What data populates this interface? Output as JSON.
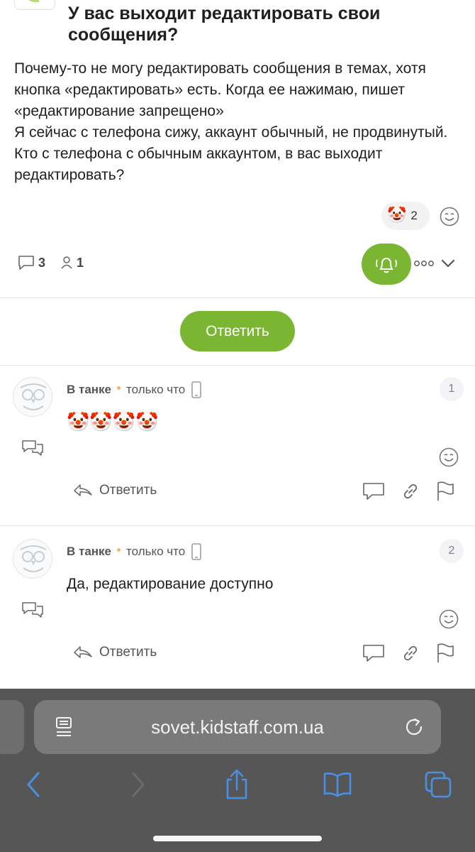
{
  "topic": {
    "title": "У вас выходит редактировать свои сообщения?",
    "body": "Почему-то не могу редактировать сообщения в темах, хотя кнопка «редактировать» есть. Когда ее нажимаю, пишет «редактирование запрещено»\nЯ сейчас с телефона сижу, аккаунт обычный, не продвинутый. Кто с телефона с обычным аккаунтом, в вас выходит редактировать?",
    "reaction": {
      "emoji": "🤡",
      "count": "2"
    },
    "comments_count": "3",
    "participants_count": "1"
  },
  "reply_button": "Ответить",
  "comments": [
    {
      "author": "В танке",
      "time": "только что",
      "number": "1",
      "text": "🤡🤡🤡🤡",
      "reply_label": "Ответить"
    },
    {
      "author": "В танке",
      "time": "только что",
      "number": "2",
      "text": "Да, редактирование доступно",
      "reply_label": "Ответить"
    }
  ],
  "browser": {
    "url": "sovet.kidstaff.com.ua"
  },
  "colors": {
    "accent": "#7ab631",
    "nav_icon": "#4a90e2",
    "toolbar": "#565656"
  }
}
